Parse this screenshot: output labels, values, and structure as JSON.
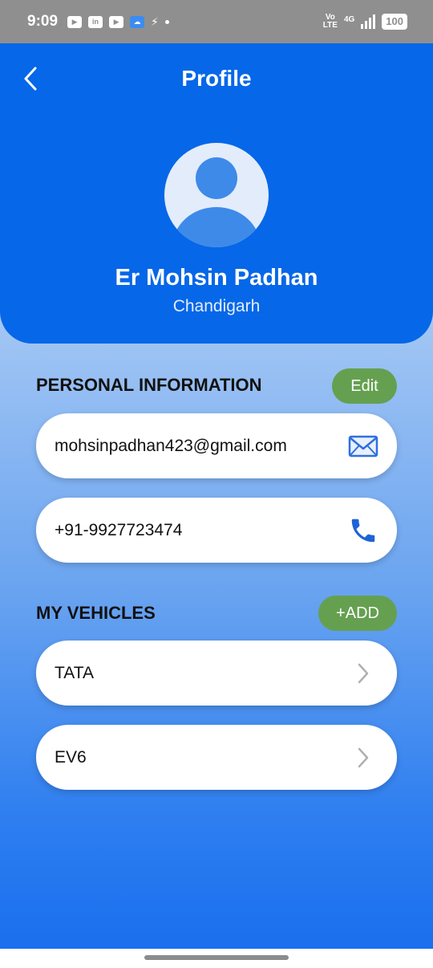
{
  "status_bar": {
    "time": "9:09",
    "network": "4G",
    "volte": "Vo LTE",
    "battery": "100"
  },
  "header": {
    "title": "Profile",
    "back_icon": "chevron-left-icon"
  },
  "profile": {
    "name": "Er Mohsin Padhan",
    "location": "Chandigarh",
    "avatar_icon": "user-avatar-icon"
  },
  "personal_info": {
    "title": "PERSONAL INFORMATION",
    "edit_label": "Edit",
    "email": "mohsinpadhan423@gmail.com",
    "email_icon": "mail-icon",
    "phone": "+91-9927723474",
    "phone_icon": "phone-icon"
  },
  "vehicles": {
    "title": "MY VEHICLES",
    "add_label": "+ADD",
    "items": [
      {
        "name": "TATA",
        "icon": "chevron-right-icon"
      },
      {
        "name": "EV6",
        "icon": "chevron-right-icon"
      }
    ]
  },
  "colors": {
    "primary": "#0667e8",
    "button_green": "#65a050",
    "icon_blue": "#1e63d6"
  }
}
